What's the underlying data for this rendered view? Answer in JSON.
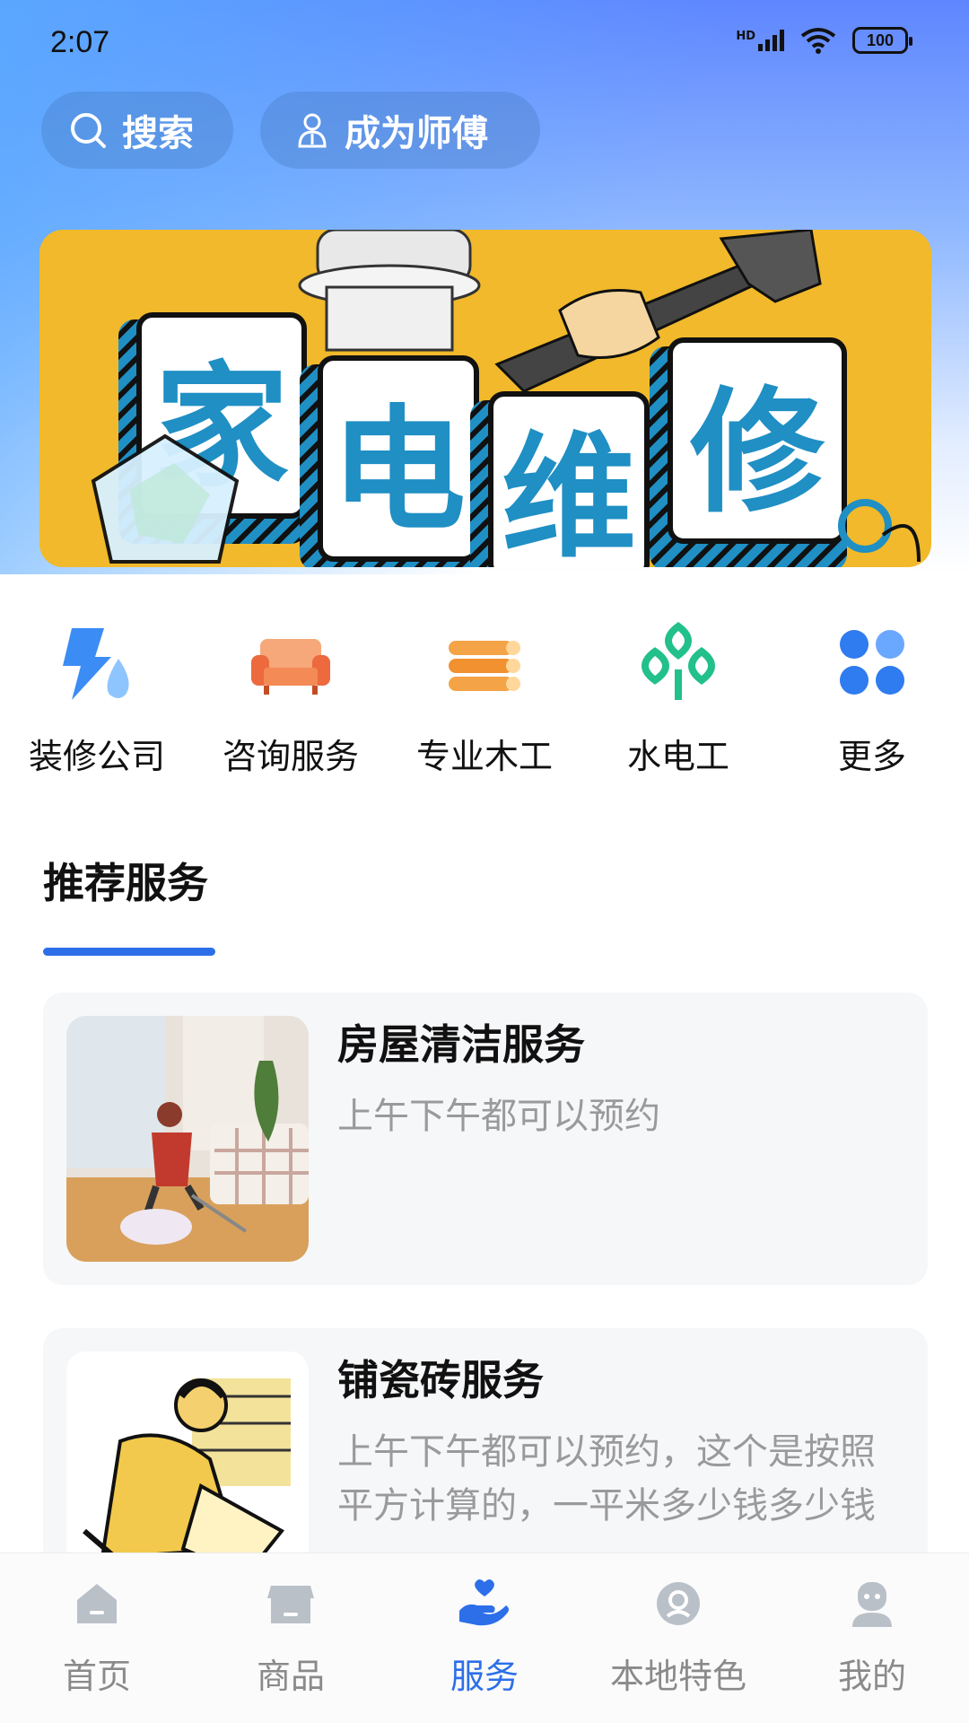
{
  "status_bar": {
    "time": "2:07",
    "network": "HD",
    "battery": "100"
  },
  "header": {
    "search_label": "搜索",
    "become_master_label": "成为师傅"
  },
  "banner": {
    "chars": [
      "家",
      "电",
      "维",
      "修"
    ]
  },
  "categories": [
    {
      "label": "装修公司",
      "icon": "renovation-icon"
    },
    {
      "label": "咨询服务",
      "icon": "sofa-icon"
    },
    {
      "label": "专业木工",
      "icon": "wood-logs-icon"
    },
    {
      "label": "水电工",
      "icon": "scales-icon"
    },
    {
      "label": "更多",
      "icon": "grid-icon"
    }
  ],
  "recommend": {
    "title": "推荐服务",
    "items": [
      {
        "title": "房屋清洁服务",
        "desc": "上午下午都可以预约"
      },
      {
        "title": "铺瓷砖服务",
        "desc": "上午下午都可以预约，这个是按照平方计算的，一平米多少钱多少钱"
      }
    ]
  },
  "tab_bar": {
    "items": [
      {
        "label": "首页",
        "icon": "home-icon"
      },
      {
        "label": "商品",
        "icon": "shop-icon"
      },
      {
        "label": "服务",
        "icon": "service-hand-icon"
      },
      {
        "label": "本地特色",
        "icon": "local-badge-icon"
      },
      {
        "label": "我的",
        "icon": "profile-icon"
      }
    ],
    "active_index": 2
  },
  "colors": {
    "accent": "#2c6fe8",
    "banner_bg": "#f1b92b",
    "tile_text": "#1f8fc4"
  }
}
